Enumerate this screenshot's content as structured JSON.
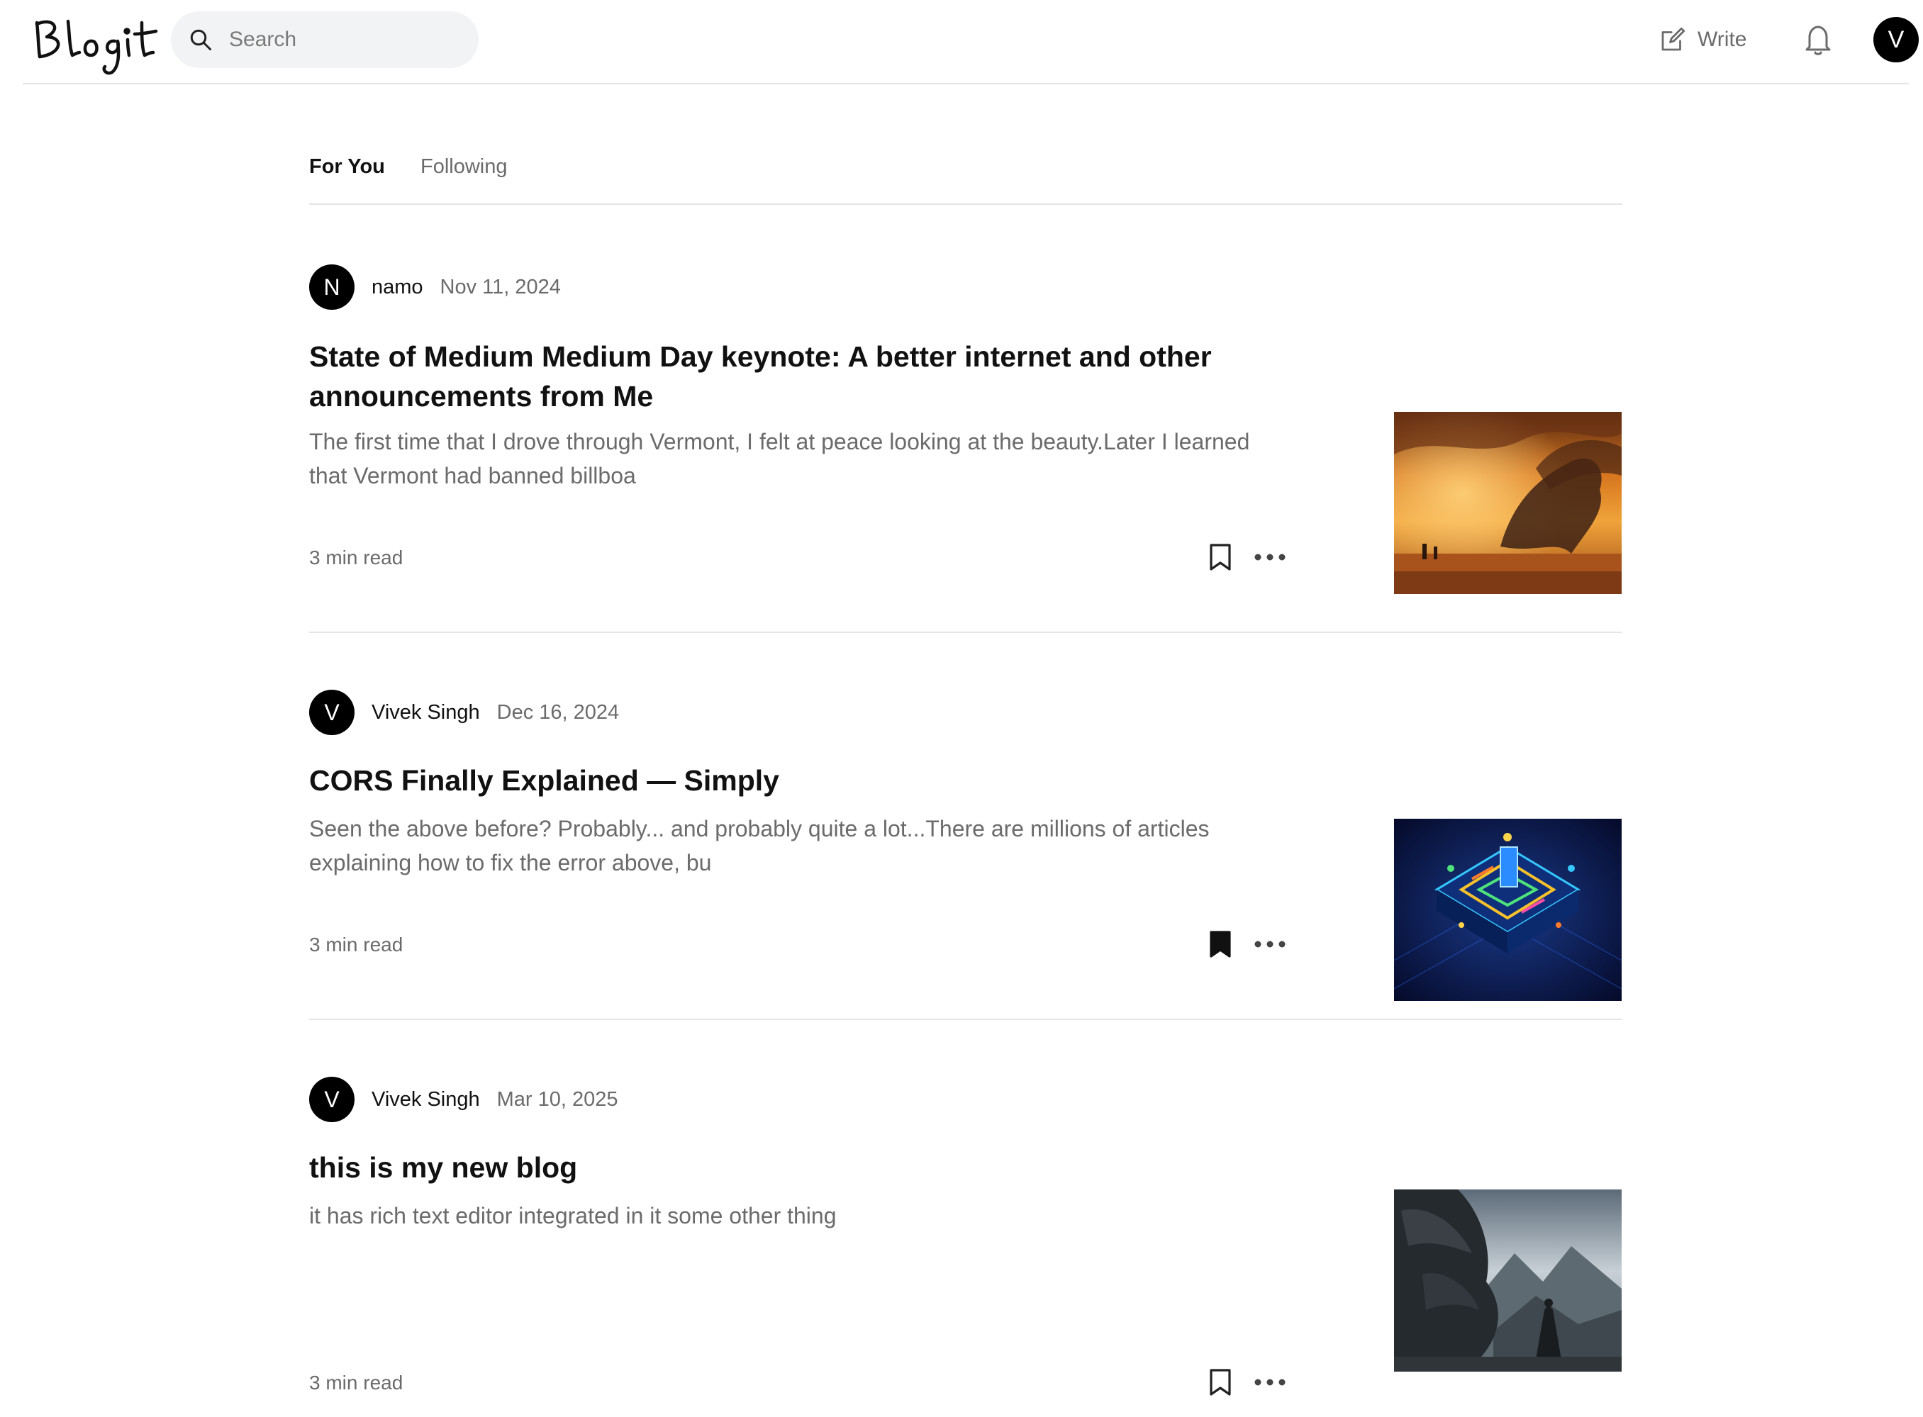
{
  "header": {
    "logo_text": "Blogit",
    "search_placeholder": "Search",
    "write_label": "Write",
    "user_initial": "V"
  },
  "tabs": [
    {
      "label": "For You",
      "active": true
    },
    {
      "label": "Following",
      "active": false
    }
  ],
  "articles": [
    {
      "author_initial": "N",
      "author": "namo",
      "date": "Nov 11, 2024",
      "title": "State of Medium Medium Day keynote: A better internet and other announcements from Me",
      "excerpt": "The first time that I drove through Vermont, I felt at peace looking at the beauty.Later I learned that Vermont had banned billboa",
      "read_time": "3 min read",
      "bookmarked": false,
      "image": "dragon-desert-sunset"
    },
    {
      "author_initial": "V",
      "author": "Vivek Singh",
      "date": "Dec 16, 2024",
      "title": "CORS Finally Explained — Simply",
      "excerpt": "Seen the above before? Probably... and probably quite a lot...There are millions of articles explaining how to fix the error above, bu",
      "read_time": "3 min read",
      "bookmarked": true,
      "image": "isometric-circuit-neon"
    },
    {
      "author_initial": "V",
      "author": "Vivek Singh",
      "date": "Mar 10, 2025",
      "title": "this is my new blog",
      "excerpt": "it has rich text editor integrated in it some other thing",
      "read_time": "3 min read",
      "bookmarked": false,
      "image": "dragon-mountain-cloaked-figure"
    }
  ],
  "colors": {
    "text_primary": "#111111",
    "text_secondary": "#6b6b6b",
    "divider": "#e5e5e5",
    "search_bg": "#f2f3f4"
  }
}
